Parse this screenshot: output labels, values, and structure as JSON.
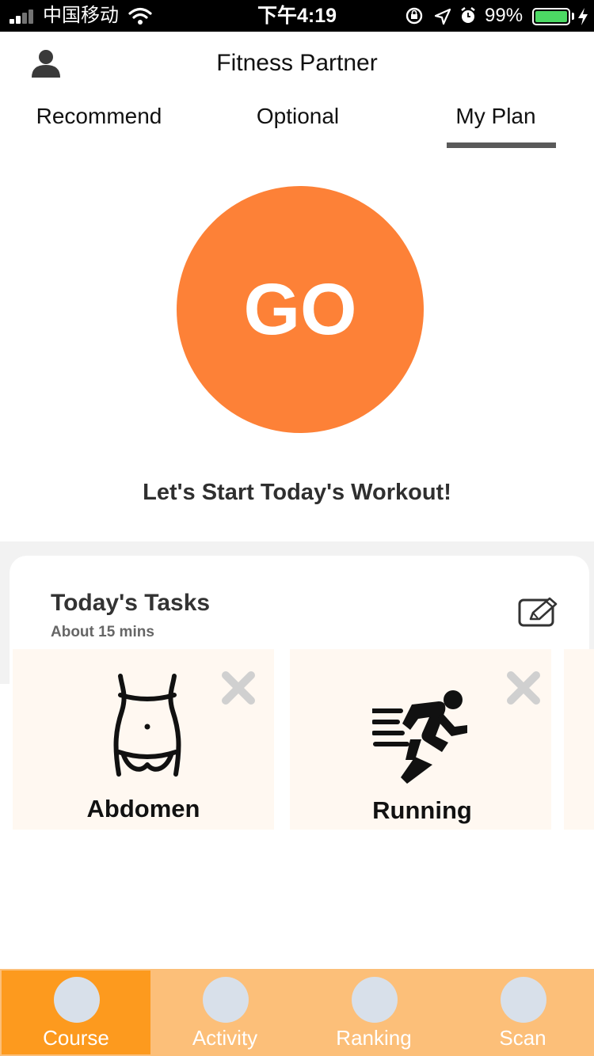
{
  "status_bar": {
    "carrier": "中国移动",
    "time": "下午4:19",
    "battery_percent": "99%",
    "battery_level": 0.99,
    "battery_color": "#4cd964"
  },
  "header": {
    "title": "Fitness Partner",
    "profile_icon": "user-silhouette-icon"
  },
  "tabs": [
    {
      "label": "Recommend",
      "active": false
    },
    {
      "label": "Optional",
      "active": false
    },
    {
      "label": "My Plan",
      "active": true
    }
  ],
  "go": {
    "label": "GO",
    "color": "#fd8137",
    "headline": "Let's Start Today's Workout!"
  },
  "tasks": {
    "title": "Today's Tasks",
    "subtitle": "About 15 mins",
    "edit_icon": "edit-icon",
    "items": [
      {
        "label": "Abdomen",
        "icon": "abdomen-icon",
        "remove_icon": "close-icon"
      },
      {
        "label": "Running",
        "icon": "runner-icon",
        "remove_icon": "close-icon"
      }
    ]
  },
  "bottom_nav": {
    "accent": "#fd9a1e",
    "background": "#fcbf79",
    "items": [
      {
        "label": "Course",
        "active": true
      },
      {
        "label": "Activity",
        "active": false
      },
      {
        "label": "Ranking",
        "active": false
      },
      {
        "label": "Scan",
        "active": false
      }
    ]
  }
}
